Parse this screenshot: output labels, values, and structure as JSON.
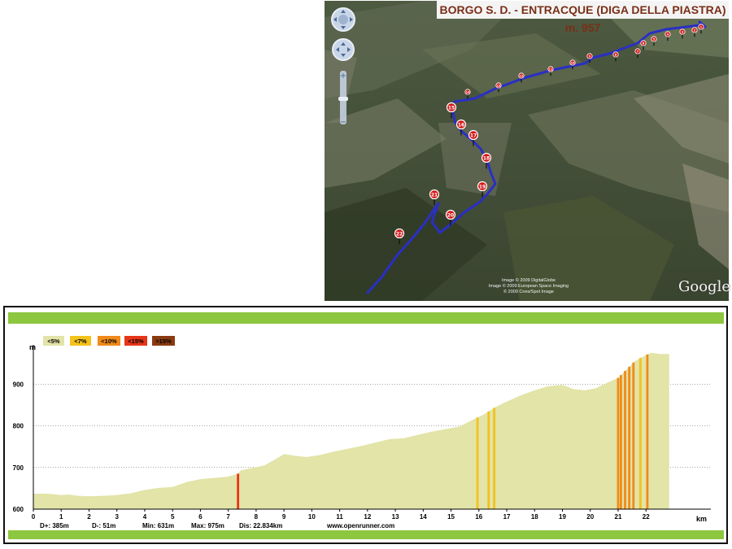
{
  "map": {
    "title": "BORGO S. D. - ENTRACQUE (DIGA DELLA PIASTRA) m. 957",
    "credits": [
      "Image © 2009 DigitalGlobe",
      "Image © 2009 European Space Imaging",
      "© 2009 Cnes/Spot Image"
    ],
    "logo": "Google",
    "markers": [
      "1",
      "2",
      "3",
      "4",
      "5",
      "6",
      "7",
      "8",
      "9",
      "10",
      "11",
      "12",
      "13",
      "14",
      "15",
      "16",
      "17",
      "18",
      "19",
      "20",
      "21",
      "22"
    ],
    "colors": {
      "route": "#2a2fc4",
      "marker": "#d31b1b"
    },
    "icons": [
      "pan-control-icon",
      "look-control-icon",
      "zoom-in-icon",
      "zoom-out-icon"
    ]
  },
  "chart_data": {
    "type": "area",
    "title": "",
    "xlabel": "km",
    "ylabel": "m",
    "xlim": [
      0,
      23.6
    ],
    "ylim": [
      600,
      1000
    ],
    "x_ticks": [
      "0",
      "1",
      "2",
      "3",
      "4",
      "5",
      "6",
      "7",
      "8",
      "9",
      "10",
      "11",
      "12",
      "13",
      "14",
      "15",
      "16",
      "17",
      "18",
      "19",
      "20",
      "21",
      "22"
    ],
    "y_ticks": [
      "600",
      "700",
      "800",
      "900"
    ],
    "grid": "dotted horizontal",
    "legend": {
      "position": "top-left",
      "items": [
        {
          "label": "<5%",
          "color": "#e2e4a8"
        },
        {
          "label": "<7%",
          "color": "#f4c21b"
        },
        {
          "label": "<10%",
          "color": "#f08a1a"
        },
        {
          "label": "<15%",
          "color": "#e63518"
        },
        {
          "label": ">15%",
          "color": "#8a3a10"
        }
      ]
    },
    "elevation": {
      "x": [
        0,
        0.5,
        1,
        1.3,
        1.6,
        2,
        2.5,
        3,
        3.5,
        4,
        4.5,
        5,
        5.5,
        6,
        6.5,
        7,
        7.35,
        7.45,
        7.8,
        8.3,
        8.7,
        9,
        9.4,
        9.8,
        10.3,
        10.8,
        11.3,
        11.8,
        12.3,
        12.8,
        13.3,
        13.8,
        14.3,
        14.8,
        15.3,
        15.8,
        16.2,
        16.6,
        17,
        17.5,
        18,
        18.5,
        19,
        19.4,
        19.8,
        20.2,
        20.6,
        21,
        21.3,
        21.6,
        22,
        22.2,
        22.5,
        22.834
      ],
      "y": [
        637,
        637,
        634,
        635,
        632,
        631,
        632,
        634,
        638,
        646,
        651,
        653,
        665,
        672,
        675,
        678,
        685,
        693,
        698,
        705,
        720,
        732,
        728,
        725,
        730,
        738,
        745,
        752,
        760,
        768,
        770,
        778,
        786,
        792,
        798,
        815,
        828,
        845,
        858,
        873,
        885,
        895,
        898,
        888,
        885,
        890,
        903,
        915,
        935,
        955,
        970,
        975,
        972,
        972
      ]
    },
    "gradient_stripes": [
      {
        "km": 7.35,
        "class": "<15%"
      },
      {
        "km": 15.95,
        "class": "<7%"
      },
      {
        "km": 16.35,
        "class": "<7%"
      },
      {
        "km": 16.55,
        "class": "<7%"
      },
      {
        "km": 21.0,
        "class": "<10%"
      },
      {
        "km": 21.1,
        "class": "<10%"
      },
      {
        "km": 21.25,
        "class": "<10%"
      },
      {
        "km": 21.4,
        "class": "<10%"
      },
      {
        "km": 21.55,
        "class": "<10%"
      },
      {
        "km": 21.8,
        "class": "<7%"
      },
      {
        "km": 22.05,
        "class": "<10%"
      }
    ],
    "stats": {
      "d_plus": "D+: 385m",
      "d_minus": "D-: 51m",
      "min": "Min: 631m",
      "max": "Max: 975m",
      "distance": "Dis: 22.834km",
      "source": "www.openrunner.com"
    },
    "colors": {
      "band": "#8dc63f",
      "fill": "#e2e4a8",
      "grid": "#555555"
    }
  }
}
